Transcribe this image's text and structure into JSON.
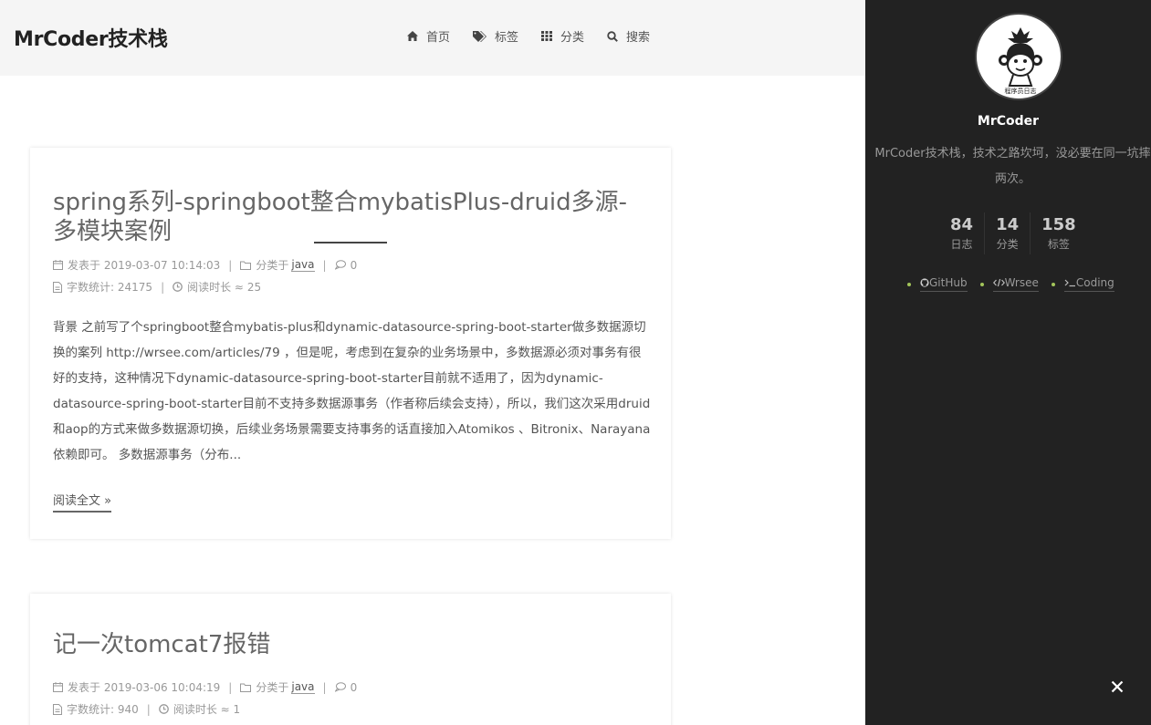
{
  "header": {
    "brand": "MrCoder技术栈",
    "nav": [
      {
        "icon": "home-icon",
        "label": "首页"
      },
      {
        "icon": "tags-icon",
        "label": "标签"
      },
      {
        "icon": "grid-icon",
        "label": "分类"
      },
      {
        "icon": "search-icon",
        "label": "搜索"
      }
    ]
  },
  "posts": [
    {
      "title": "spring系列-springboot整合mybatisPlus-druid多源-多模块案例",
      "published_label": "发表于",
      "published": "2019-03-07 10:14:03",
      "category_label": "分类于",
      "category": "java",
      "comments": "0",
      "wordcount_label": "字数统计:",
      "wordcount": "24175",
      "readtime_label": "阅读时长 ≈",
      "readtime": "25",
      "excerpt": "背景 之前写了个springboot整合mybatis-plus和dynamic-datasource-spring-boot-starter做多数据源切换的案列 http://wrsee.com/articles/79 ，但是呢，考虑到在复杂的业务场景中，多数据源必须对事务有很好的支持，这种情况下dynamic-datasource-spring-boot-starter目前就不适用了，因为dynamic-datasource-spring-boot-starter目前不支持多数据源事务（作者称后续会支持），所以，我们这次采用druid和aop的方式来做多数据源切换，后续业务场景需要支持事务的话直接加入Atomikos 、Bitronix、Narayana依赖即可。 多数据源事务（分布...",
      "read_more": "阅读全文 »"
    },
    {
      "title": "记一次tomcat7报错",
      "published_label": "发表于",
      "published": "2019-03-06 10:04:19",
      "category_label": "分类于",
      "category": "java",
      "comments": "0",
      "wordcount_label": "字数统计:",
      "wordcount": "940",
      "readtime_label": "阅读时长 ≈",
      "readtime": "1"
    }
  ],
  "sidebar": {
    "avatar_icon": "monkey-avatar-icon",
    "avatar_caption": "程序员日志",
    "author": "MrCoder",
    "description": "MrCoder技术栈，技术之路坎坷，没必要在同一坑摔两次。",
    "stats": [
      {
        "value": "84",
        "label": "日志"
      },
      {
        "value": "14",
        "label": "分类"
      },
      {
        "value": "158",
        "label": "标签"
      }
    ],
    "links": [
      {
        "icon": "github-icon",
        "label": "GitHub"
      },
      {
        "icon": "code-icon",
        "label": "Wrsee"
      },
      {
        "icon": "terminal-icon",
        "label": "Coding"
      }
    ],
    "close_icon": "close-icon"
  },
  "colors": {
    "sidebar_bg": "#222222",
    "header_bg": "#f5f5f5",
    "accent_dot": "#a3c55a"
  }
}
